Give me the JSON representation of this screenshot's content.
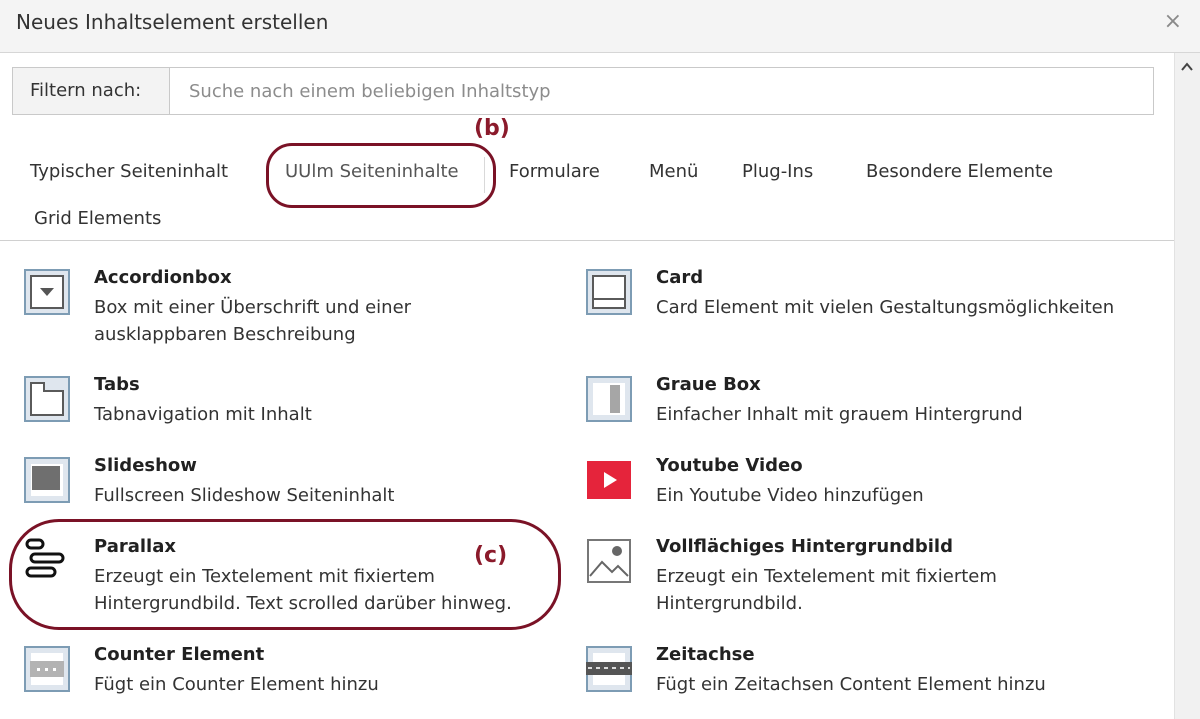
{
  "dialog": {
    "title": "Neues Inhaltselement erstellen",
    "close_symbol": "×"
  },
  "filter": {
    "label": "Filtern nach:",
    "placeholder": "Suche nach einem beliebigen Inhaltstyp",
    "value": ""
  },
  "tabs": [
    {
      "label": "Typischer Seiteninhalt",
      "active": false
    },
    {
      "label": "UUlm Seiteninhalte",
      "active": true
    },
    {
      "label": "Formulare",
      "active": false
    },
    {
      "label": "Menü",
      "active": false
    },
    {
      "label": "Plug-Ins",
      "active": false
    },
    {
      "label": "Besondere Elemente",
      "active": false
    },
    {
      "label": "Grid Elements",
      "active": false
    }
  ],
  "annotations": {
    "b": "(b)",
    "c": "(c)"
  },
  "items": [
    {
      "icon": "accordion-icon",
      "title": "Accordionbox",
      "description": "Box mit einer Überschrift und einer ausklappbaren Beschreibung"
    },
    {
      "icon": "card-icon",
      "title": "Card",
      "description": "Card Element mit vielen Gestaltungsmöglichkeiten"
    },
    {
      "icon": "tabs-icon",
      "title": "Tabs",
      "description": "Tabnavigation mit Inhalt"
    },
    {
      "icon": "grey-box-icon",
      "title": "Graue Box",
      "description": "Einfacher Inhalt mit grauem Hintergrund"
    },
    {
      "icon": "slideshow-icon",
      "title": "Slideshow",
      "description": "Fullscreen Slideshow Seiteninhalt"
    },
    {
      "icon": "youtube-icon",
      "title": "Youtube Video",
      "description": "Ein Youtube Video hinzufügen"
    },
    {
      "icon": "parallax-icon",
      "title": "Parallax",
      "description": "Erzeugt ein Textelement mit fixiertem Hintergrundbild. Text scrolled darüber hinweg."
    },
    {
      "icon": "image-icon",
      "title": "Vollflächiges Hintergrundbild",
      "description": "Erzeugt ein Textelement mit fixiertem Hintergrundbild."
    },
    {
      "icon": "counter-icon",
      "title": "Counter Element",
      "description": "Fügt ein Counter Element hinzu"
    },
    {
      "icon": "timeline-icon",
      "title": "Zeitachse",
      "description": "Fügt ein Zeitachsen Content Element hinzu"
    }
  ],
  "colors": {
    "annotation": "#7a1226",
    "youtube": "#e5243b",
    "icon_blue": "#7d9cb4"
  }
}
